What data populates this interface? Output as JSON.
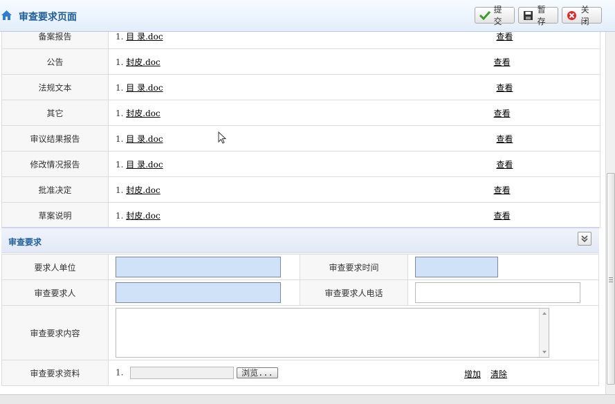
{
  "header": {
    "title": "审查要求页面",
    "buttons": {
      "submit": "提交",
      "save": "暂存",
      "close": "关闭"
    }
  },
  "documents": [
    {
      "label": "备案报告",
      "index": "1.",
      "file": "目 录.doc",
      "action": "查看"
    },
    {
      "label": "公告",
      "index": "1.",
      "file": "封皮.doc",
      "action": "查看"
    },
    {
      "label": "法规文本",
      "index": "1.",
      "file": "目 录.doc",
      "action": "查看"
    },
    {
      "label": "其它",
      "index": "1.",
      "file": "封皮.doc",
      "action": "查看"
    },
    {
      "label": "审议结果报告",
      "index": "1.",
      "file": "目 录.doc",
      "action": "查看"
    },
    {
      "label": "修改情况报告",
      "index": "1.",
      "file": "目 录.doc",
      "action": "查看"
    },
    {
      "label": "批准决定",
      "index": "1.",
      "file": "封皮.doc",
      "action": "查看"
    },
    {
      "label": "草案说明",
      "index": "1.",
      "file": "封皮.doc",
      "action": "查看"
    }
  ],
  "section": {
    "title": "审查要求"
  },
  "form": {
    "requester_unit_label": "要求人单位",
    "request_time_label": "审查要求时间",
    "requester_label": "审查要求人",
    "requester_phone_label": "审查要求人电话",
    "content_label": "审查要求内容",
    "materials_label": "审查要求资料",
    "materials_index": "1.",
    "browse_label": "浏览...",
    "add_label": "增加",
    "clear_label": "清除"
  }
}
